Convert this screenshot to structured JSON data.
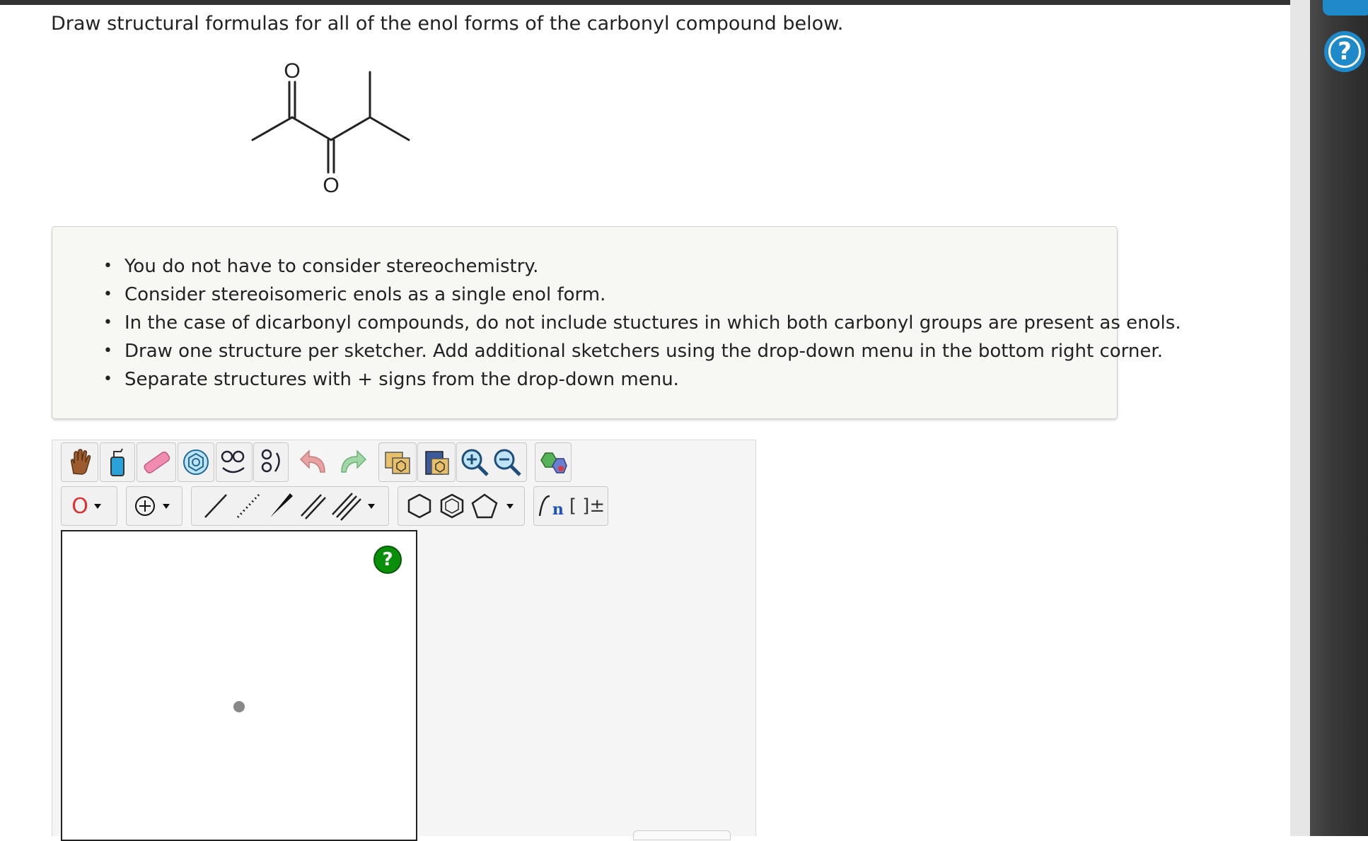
{
  "question": "Draw structural formulas for all of the enol forms of the carbonyl compound below.",
  "molecule": {
    "atoms": [
      "O",
      "O"
    ]
  },
  "instructions": [
    "You do not have to consider stereochemistry.",
    "Consider stereoisomeric enols as a single enol form.",
    "In the case of dicarbonyl compounds, do not include stuctures in which both carbonyl groups are present as enols.",
    "Draw one structure per sketcher. Add additional sketchers using the drop-down menu in the bottom right corner.",
    "Separate structures with + signs from the drop-down menu."
  ],
  "toolbar": {
    "row1": [
      "hand-tool",
      "clear-tool",
      "eraser-tool",
      "ring-template-tool",
      "chain-template-tool",
      "rotate-tool",
      "undo-tool",
      "redo-tool",
      "copy-tool",
      "paste-tool",
      "zoom-in-tool",
      "zoom-out-tool",
      "clean-structure-tool"
    ],
    "element_label": "O",
    "charge_label": "+",
    "sgroup_label": "n",
    "bracket_label": "[ ]±"
  },
  "sketcher_help": "?",
  "right_rail": {
    "help": "?"
  },
  "colors": {
    "accent": "#1f8ac9",
    "help_green": "#0a8f0a",
    "oxygen": "#e03030"
  }
}
